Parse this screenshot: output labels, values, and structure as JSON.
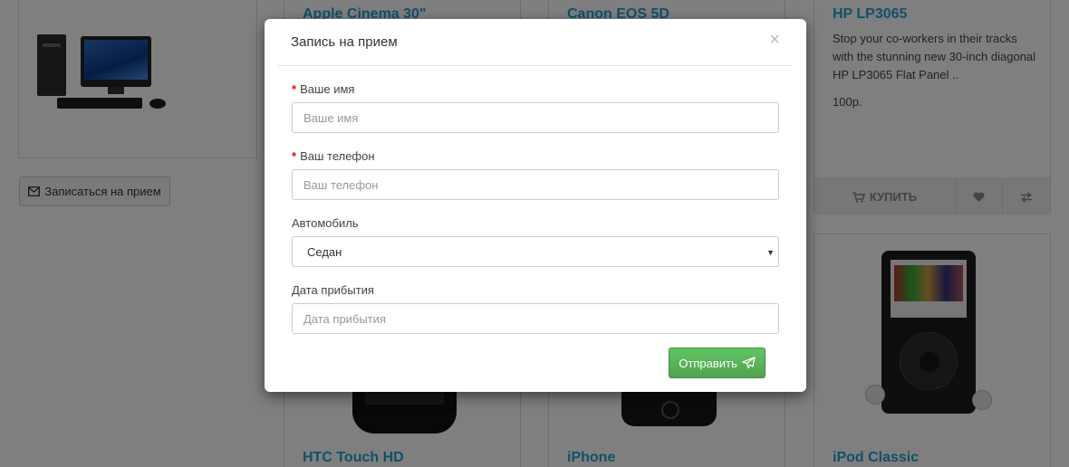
{
  "store": {
    "appointment_button": "Записаться на прием",
    "cards": [
      {
        "title": "Apple Cinema 30\""
      },
      {
        "title": "Canon EOS 5D"
      },
      {
        "title": "HP LP3065",
        "description": "Stop your co-workers in their tracks with the stunning new 30-inch diagonal HP LP3065 Flat Panel ..",
        "price": "100р.",
        "buy_label": "КУПИТЬ"
      },
      {
        "title": "HTC Touch HD"
      },
      {
        "title": "iPhone"
      },
      {
        "title": "iPod Classic"
      }
    ]
  },
  "modal": {
    "title": "Запись на прием",
    "close": "×",
    "name_label": "Ваше имя",
    "name_placeholder": "Ваше имя",
    "phone_label": "Ваш телефон",
    "phone_placeholder": "Ваш телефон",
    "car_label": "Автомобиль",
    "car_value": "Седан",
    "date_label": "Дата прибытия",
    "date_placeholder": "Дата прибытия",
    "submit_label": "Отправить"
  },
  "icons": {
    "appointment": "envelope-icon",
    "buy": "cart-icon",
    "wishlist": "heart-icon",
    "compare": "compare-icon",
    "submit": "paper-plane-icon",
    "select": "caret-down-icon"
  },
  "colors": {
    "link": "#23a1d1",
    "submit": "#5bb75b",
    "required": "#ff0000"
  }
}
